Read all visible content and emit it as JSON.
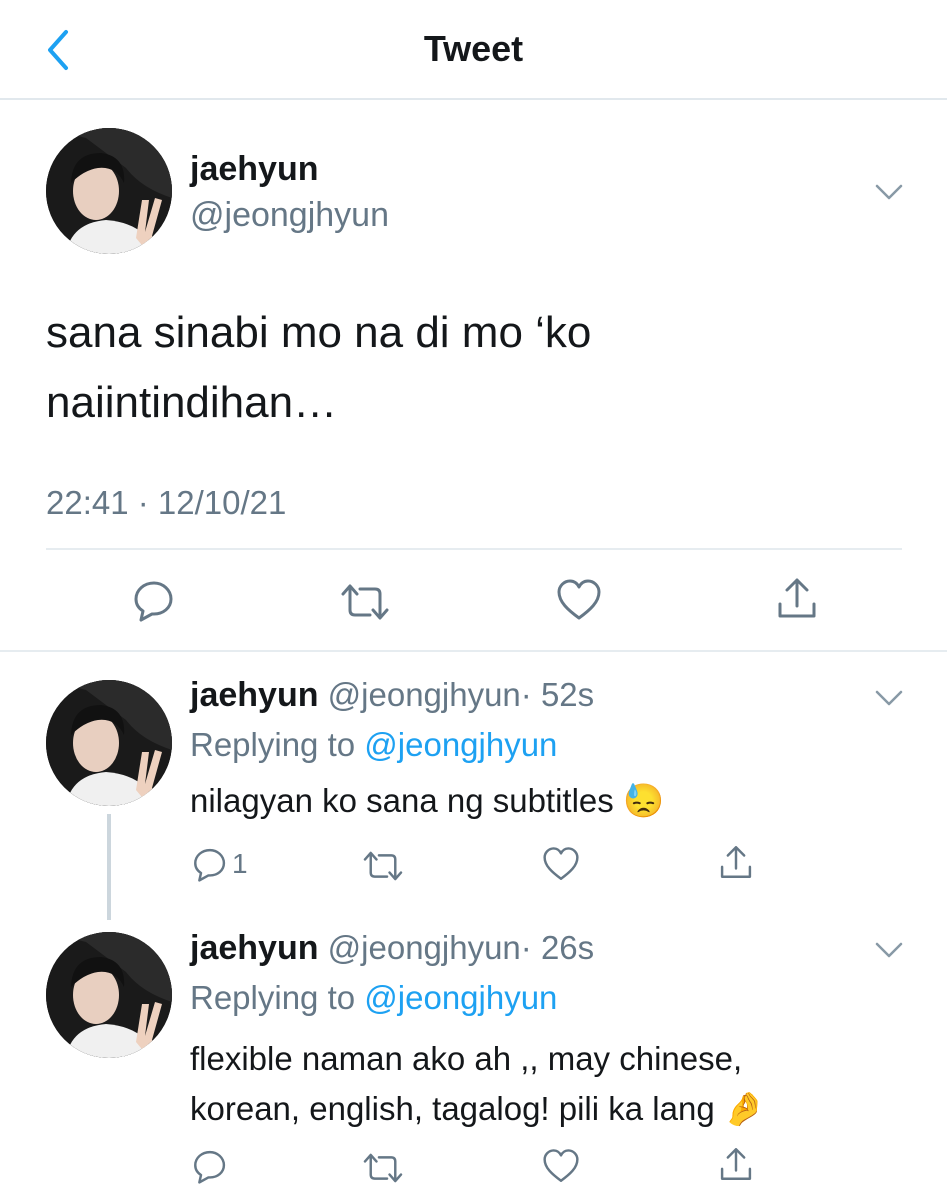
{
  "header": {
    "title": "Tweet",
    "back_icon": "chevron-left-icon"
  },
  "main_tweet": {
    "display_name": "jaehyun",
    "handle": "@jeongjhyun",
    "text_line1": "sana sinabi mo na di mo ‘ko",
    "text_line2": "naiintindihan…",
    "timestamp": "22:41 · 12/10/21",
    "actions": [
      "reply-icon",
      "retweet-icon",
      "like-icon",
      "share-icon"
    ]
  },
  "replies": [
    {
      "display_name": "jaehyun",
      "handle": "@jeongjhyun",
      "time": "· 52s",
      "replying_prefix": "Replying to",
      "replying_handle": "@jeongjhyun",
      "text_line1": "nilagyan ko sana ng subtitles",
      "emoji": "😓",
      "reply_count": "1"
    },
    {
      "display_name": "jaehyun",
      "handle": "@jeongjhyun",
      "time": "· 26s",
      "replying_prefix": "Replying to",
      "replying_handle": "@jeongjhyun",
      "text_line1": "flexible naman ako ah ,, may chinese,",
      "text_line2": "korean, english, tagalog! pili ka lang",
      "emoji": "🤌",
      "reply_count": ""
    }
  ],
  "colors": {
    "accent": "#1da1f2",
    "text": "#14171a",
    "muted": "#657786",
    "border": "#e6ecf0"
  }
}
